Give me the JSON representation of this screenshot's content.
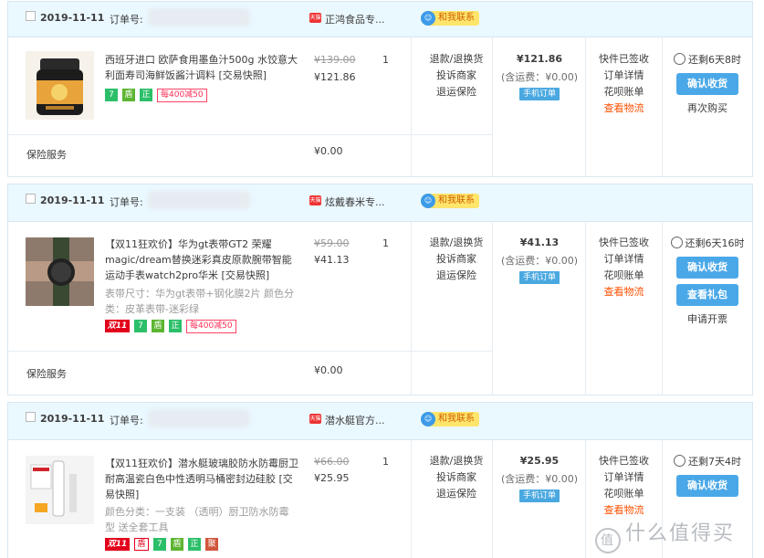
{
  "order_no_label": "订单号:",
  "orders": [
    {
      "date": "2019-11-11",
      "shop": "正鸿食品专...",
      "contact": "和我联系",
      "title": "西班牙进口 欧萨食用墨鱼汁500g 水饺意大利面寿司海鲜饭酱汁调料 [交易快照]",
      "spec": "",
      "tags": [
        "7",
        "盾",
        "正",
        "每400减50"
      ],
      "orig_price": "¥139.00",
      "price": "¥121.86",
      "qty": "1",
      "links": [
        "退款/退换货",
        "投诉商家",
        "退运保险"
      ],
      "total": "¥121.86",
      "shipping": "(含运费：¥0.00)",
      "mobile_order": "手机订单",
      "status": [
        "快件已签收",
        "订单详情",
        "花呗账单"
      ],
      "logistics": "查看物流",
      "countdown": "还剩6天8时",
      "buttons": [
        "确认收货"
      ],
      "extra": "再次购买",
      "service_label": "保险服务",
      "service_price": "¥0.00"
    },
    {
      "date": "2019-11-11",
      "shop": "炫戴春米专...",
      "contact": "和我联系",
      "title": "【双11狂欢价】华为gt表带GT2 荣耀magic/dream替换迷彩真皮原款腕带智能运动手表watch2pro华米 [交易快照]",
      "spec": "表带尺寸：华为gt表带+钢化膜2片  颜色分类：皮革表带-迷彩绿",
      "tags": [
        "双11",
        "7",
        "盾",
        "正",
        "每400减50"
      ],
      "orig_price": "¥59.00",
      "price": "¥41.13",
      "qty": "1",
      "links": [
        "退款/退换货",
        "投诉商家",
        "退运保险"
      ],
      "total": "¥41.13",
      "shipping": "(含运费：¥0.00)",
      "mobile_order": "手机订单",
      "status": [
        "快件已签收",
        "订单详情",
        "花呗账单"
      ],
      "logistics": "查看物流",
      "countdown": "还剩6天16时",
      "buttons": [
        "确认收货",
        "查看礼包"
      ],
      "extra": "申请开票",
      "service_label": "保险服务",
      "service_price": "¥0.00"
    },
    {
      "date": "2019-11-11",
      "shop": "潜水艇官方...",
      "contact": "和我联系",
      "title": "【双11狂欢价】潜水艇玻璃胶防水防霉厨卫耐高温瓷白色中性透明马桶密封边硅胶 [交易快照]",
      "spec": "颜色分类：一支装 （透明）厨卫防水防霉型 送全套工具",
      "tags": [
        "双11",
        "盾",
        "7",
        "盾",
        "正",
        "聚"
      ],
      "orig_price": "¥66.00",
      "price": "¥25.95",
      "qty": "1",
      "links": [
        "退款/退换货",
        "投诉商家",
        "退运保险"
      ],
      "total": "¥25.95",
      "shipping": "(含运费：¥0.00)",
      "mobile_order": "手机订单",
      "status": [
        "快件已签收",
        "订单详情",
        "花呗账单"
      ],
      "logistics": "查看物流",
      "countdown": "还剩7天4时",
      "buttons": [
        "确认收货"
      ],
      "extra": "",
      "service_label": "",
      "service_price": ""
    }
  ],
  "watermark": "什么值得买",
  "colors": {
    "header_bg": "#eaf8ff",
    "button": "#4aa8e8",
    "logistics": "#ff5000",
    "promo": "#ff2d55"
  }
}
